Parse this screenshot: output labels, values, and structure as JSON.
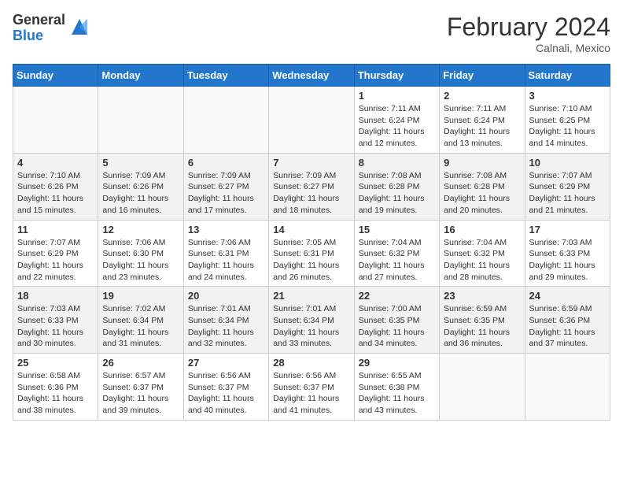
{
  "logo": {
    "general": "General",
    "blue": "Blue"
  },
  "title": "February 2024",
  "subtitle": "Calnali, Mexico",
  "days_of_week": [
    "Sunday",
    "Monday",
    "Tuesday",
    "Wednesday",
    "Thursday",
    "Friday",
    "Saturday"
  ],
  "weeks": [
    [
      {
        "day": "",
        "empty": true
      },
      {
        "day": "",
        "empty": true
      },
      {
        "day": "",
        "empty": true
      },
      {
        "day": "",
        "empty": true
      },
      {
        "day": "1",
        "sunrise": "7:11 AM",
        "sunset": "6:24 PM",
        "daylight": "11 hours and 12 minutes."
      },
      {
        "day": "2",
        "sunrise": "7:11 AM",
        "sunset": "6:24 PM",
        "daylight": "11 hours and 13 minutes."
      },
      {
        "day": "3",
        "sunrise": "7:10 AM",
        "sunset": "6:25 PM",
        "daylight": "11 hours and 14 minutes."
      }
    ],
    [
      {
        "day": "4",
        "sunrise": "7:10 AM",
        "sunset": "6:26 PM",
        "daylight": "11 hours and 15 minutes."
      },
      {
        "day": "5",
        "sunrise": "7:09 AM",
        "sunset": "6:26 PM",
        "daylight": "11 hours and 16 minutes."
      },
      {
        "day": "6",
        "sunrise": "7:09 AM",
        "sunset": "6:27 PM",
        "daylight": "11 hours and 17 minutes."
      },
      {
        "day": "7",
        "sunrise": "7:09 AM",
        "sunset": "6:27 PM",
        "daylight": "11 hours and 18 minutes."
      },
      {
        "day": "8",
        "sunrise": "7:08 AM",
        "sunset": "6:28 PM",
        "daylight": "11 hours and 19 minutes."
      },
      {
        "day": "9",
        "sunrise": "7:08 AM",
        "sunset": "6:28 PM",
        "daylight": "11 hours and 20 minutes."
      },
      {
        "day": "10",
        "sunrise": "7:07 AM",
        "sunset": "6:29 PM",
        "daylight": "11 hours and 21 minutes."
      }
    ],
    [
      {
        "day": "11",
        "sunrise": "7:07 AM",
        "sunset": "6:29 PM",
        "daylight": "11 hours and 22 minutes."
      },
      {
        "day": "12",
        "sunrise": "7:06 AM",
        "sunset": "6:30 PM",
        "daylight": "11 hours and 23 minutes."
      },
      {
        "day": "13",
        "sunrise": "7:06 AM",
        "sunset": "6:31 PM",
        "daylight": "11 hours and 24 minutes."
      },
      {
        "day": "14",
        "sunrise": "7:05 AM",
        "sunset": "6:31 PM",
        "daylight": "11 hours and 26 minutes."
      },
      {
        "day": "15",
        "sunrise": "7:04 AM",
        "sunset": "6:32 PM",
        "daylight": "11 hours and 27 minutes."
      },
      {
        "day": "16",
        "sunrise": "7:04 AM",
        "sunset": "6:32 PM",
        "daylight": "11 hours and 28 minutes."
      },
      {
        "day": "17",
        "sunrise": "7:03 AM",
        "sunset": "6:33 PM",
        "daylight": "11 hours and 29 minutes."
      }
    ],
    [
      {
        "day": "18",
        "sunrise": "7:03 AM",
        "sunset": "6:33 PM",
        "daylight": "11 hours and 30 minutes."
      },
      {
        "day": "19",
        "sunrise": "7:02 AM",
        "sunset": "6:34 PM",
        "daylight": "11 hours and 31 minutes."
      },
      {
        "day": "20",
        "sunrise": "7:01 AM",
        "sunset": "6:34 PM",
        "daylight": "11 hours and 32 minutes."
      },
      {
        "day": "21",
        "sunrise": "7:01 AM",
        "sunset": "6:34 PM",
        "daylight": "11 hours and 33 minutes."
      },
      {
        "day": "22",
        "sunrise": "7:00 AM",
        "sunset": "6:35 PM",
        "daylight": "11 hours and 34 minutes."
      },
      {
        "day": "23",
        "sunrise": "6:59 AM",
        "sunset": "6:35 PM",
        "daylight": "11 hours and 36 minutes."
      },
      {
        "day": "24",
        "sunrise": "6:59 AM",
        "sunset": "6:36 PM",
        "daylight": "11 hours and 37 minutes."
      }
    ],
    [
      {
        "day": "25",
        "sunrise": "6:58 AM",
        "sunset": "6:36 PM",
        "daylight": "11 hours and 38 minutes."
      },
      {
        "day": "26",
        "sunrise": "6:57 AM",
        "sunset": "6:37 PM",
        "daylight": "11 hours and 39 minutes."
      },
      {
        "day": "27",
        "sunrise": "6:56 AM",
        "sunset": "6:37 PM",
        "daylight": "11 hours and 40 minutes."
      },
      {
        "day": "28",
        "sunrise": "6:56 AM",
        "sunset": "6:37 PM",
        "daylight": "11 hours and 41 minutes."
      },
      {
        "day": "29",
        "sunrise": "6:55 AM",
        "sunset": "6:38 PM",
        "daylight": "11 hours and 43 minutes."
      },
      {
        "day": "",
        "empty": true
      },
      {
        "day": "",
        "empty": true
      }
    ]
  ]
}
